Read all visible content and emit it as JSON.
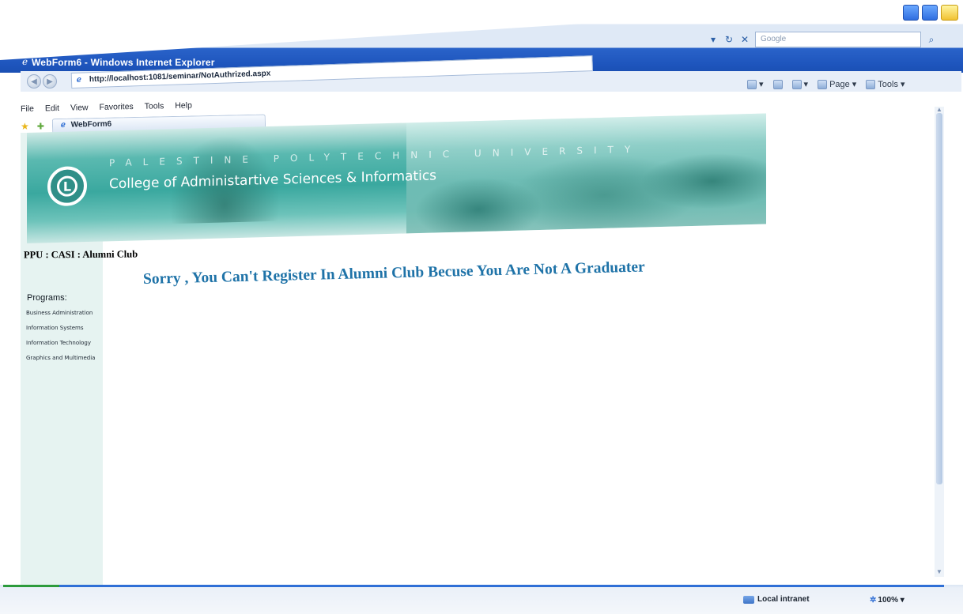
{
  "window": {
    "title": "WebForm6 - Windows Internet Explorer",
    "search_placeholder": "Google"
  },
  "address": {
    "url": "http://localhost:1081/seminar/NotAuthrized.aspx"
  },
  "command_bar": {
    "page_label": "Page",
    "tools_label": "Tools"
  },
  "menu": {
    "items": [
      "File",
      "Edit",
      "View",
      "Favorites",
      "Tools",
      "Help"
    ]
  },
  "tabs": {
    "active_label": "WebForm6"
  },
  "banner": {
    "subtitle_spaced": "PALESTINE POLYTECHNIC UNIVERSITY",
    "college": "College of Administartive Sciences & Informatics"
  },
  "page": {
    "breadcrumb": "PPU : CASI : Alumni Club",
    "message": "Sorry , You Can't Register In Alumni Club Becuse You Are Not A Graduater"
  },
  "sidebar": {
    "title": "Programs:",
    "items": [
      "Business Administration",
      "Information Systems",
      "Information Technology",
      "Graphics and Multimedia"
    ]
  },
  "status": {
    "zone": "Local intranet",
    "zoom": "100%",
    "progress_fraction": 0.06
  }
}
